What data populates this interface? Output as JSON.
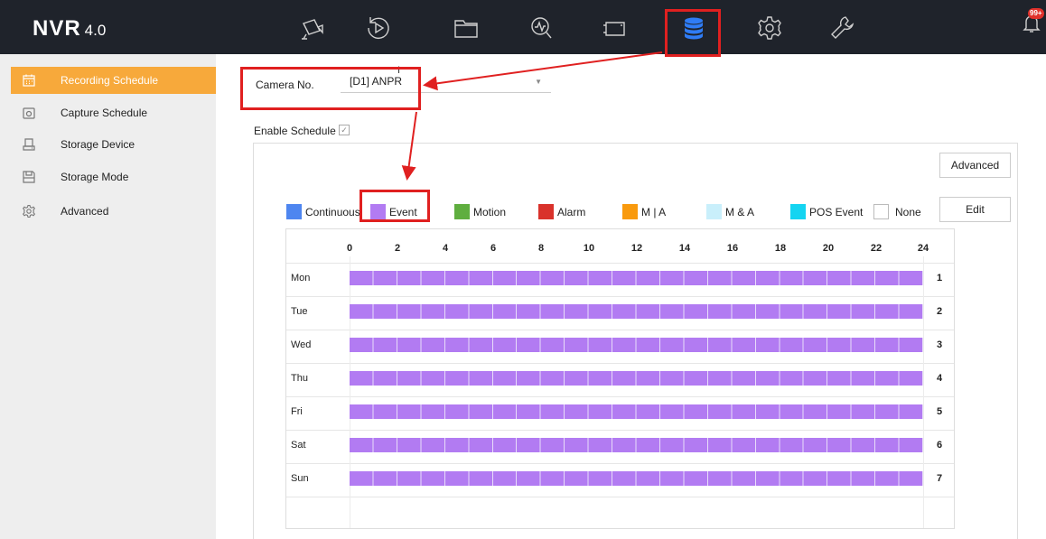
{
  "app": {
    "name": "NVR",
    "version": "4.0"
  },
  "topnav": [
    {
      "name": "live-view-icon",
      "icon": "camera-icon"
    },
    {
      "name": "playback-icon",
      "icon": "playback-icon"
    },
    {
      "name": "file-management-icon",
      "icon": "folder-icon"
    },
    {
      "name": "smart-analysis-icon",
      "icon": "search-chart-icon"
    },
    {
      "name": "camera-management-icon",
      "icon": "video-camera-icon"
    },
    {
      "name": "storage-icon",
      "icon": "database-icon",
      "active": true
    },
    {
      "name": "configuration-icon",
      "icon": "gear-icon"
    },
    {
      "name": "maintenance-icon",
      "icon": "wrench-icon"
    }
  ],
  "notifications": {
    "badge": "99+"
  },
  "sidebar": {
    "items": [
      {
        "label": "Recording Schedule",
        "icon": "calendar-icon",
        "active": true
      },
      {
        "label": "Capture Schedule",
        "icon": "camera-icon"
      },
      {
        "label": "Storage Device",
        "icon": "hdd-icon"
      },
      {
        "label": "Storage Mode",
        "icon": "floppy-icon"
      },
      {
        "label": "Advanced",
        "icon": "gear-icon"
      }
    ]
  },
  "camera": {
    "label": "Camera No.",
    "value": "[D1] ANPR"
  },
  "schedule": {
    "enable_label": "Enable Schedule",
    "enabled": true,
    "advanced_button": "Advanced",
    "edit_button": "Edit",
    "legend": [
      {
        "label": "Continuous",
        "color": "#4e86f0"
      },
      {
        "label": "Event",
        "color": "#b27bf2"
      },
      {
        "label": "Motion",
        "color": "#5fae3f"
      },
      {
        "label": "Alarm",
        "color": "#d9322b"
      },
      {
        "label": "M | A",
        "color": "#f99a0d"
      },
      {
        "label": "M & A",
        "color": "#c9effb"
      },
      {
        "label": "POS Event",
        "color": "#14d4f1"
      },
      {
        "label": "None",
        "color": "#ffffff"
      }
    ],
    "hour_ticks": [
      "0",
      "2",
      "4",
      "6",
      "8",
      "10",
      "12",
      "14",
      "16",
      "18",
      "20",
      "22",
      "24"
    ],
    "days": [
      {
        "label": "Mon",
        "num": "1",
        "type": "Event"
      },
      {
        "label": "Tue",
        "num": "2",
        "type": "Event"
      },
      {
        "label": "Wed",
        "num": "3",
        "type": "Event"
      },
      {
        "label": "Thu",
        "num": "4",
        "type": "Event"
      },
      {
        "label": "Fri",
        "num": "5",
        "type": "Event"
      },
      {
        "label": "Sat",
        "num": "6",
        "type": "Event"
      },
      {
        "label": "Sun",
        "num": "7",
        "type": "Event"
      }
    ]
  }
}
